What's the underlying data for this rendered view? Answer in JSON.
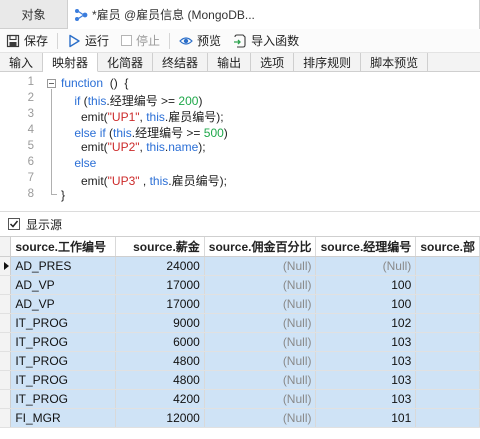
{
  "tabs": {
    "object_label": "对象",
    "active_label": "*雇员 @雇员信息 (MongoDB..."
  },
  "toolbar": {
    "save": "保存",
    "run": "运行",
    "stop": "停止",
    "preview": "预览",
    "import_function": "导入函数"
  },
  "subtabs": [
    "输入",
    "映射器",
    "化简器",
    "终结器",
    "输出",
    "选项",
    "排序规则",
    "脚本预览"
  ],
  "subtab_active_index": 1,
  "editor": {
    "line_numbers": [
      "1",
      "2",
      "3",
      "4",
      "5",
      "6",
      "7",
      "8"
    ]
  },
  "show_source_label": "显示源",
  "grid": {
    "columns": [
      "source.工作编号",
      "source.薪金",
      "source.佣金百分比",
      "source.经理编号",
      "source.部"
    ],
    "rows": [
      [
        "AD_PRES",
        "24000",
        "(Null)",
        "(Null)"
      ],
      [
        "AD_VP",
        "17000",
        "(Null)",
        "100"
      ],
      [
        "AD_VP",
        "17000",
        "(Null)",
        "100"
      ],
      [
        "IT_PROG",
        "9000",
        "(Null)",
        "102"
      ],
      [
        "IT_PROG",
        "6000",
        "(Null)",
        "103"
      ],
      [
        "IT_PROG",
        "4800",
        "(Null)",
        "103"
      ],
      [
        "IT_PROG",
        "4800",
        "(Null)",
        "103"
      ],
      [
        "IT_PROG",
        "4200",
        "(Null)",
        "103"
      ],
      [
        "FI_MGR",
        "12000",
        "(Null)",
        "101"
      ]
    ]
  },
  "colors": {
    "keyword": "#2b6fd6",
    "string": "#cc2a2a",
    "number": "#1fa84a",
    "row_selected": "#cfe3f6"
  }
}
